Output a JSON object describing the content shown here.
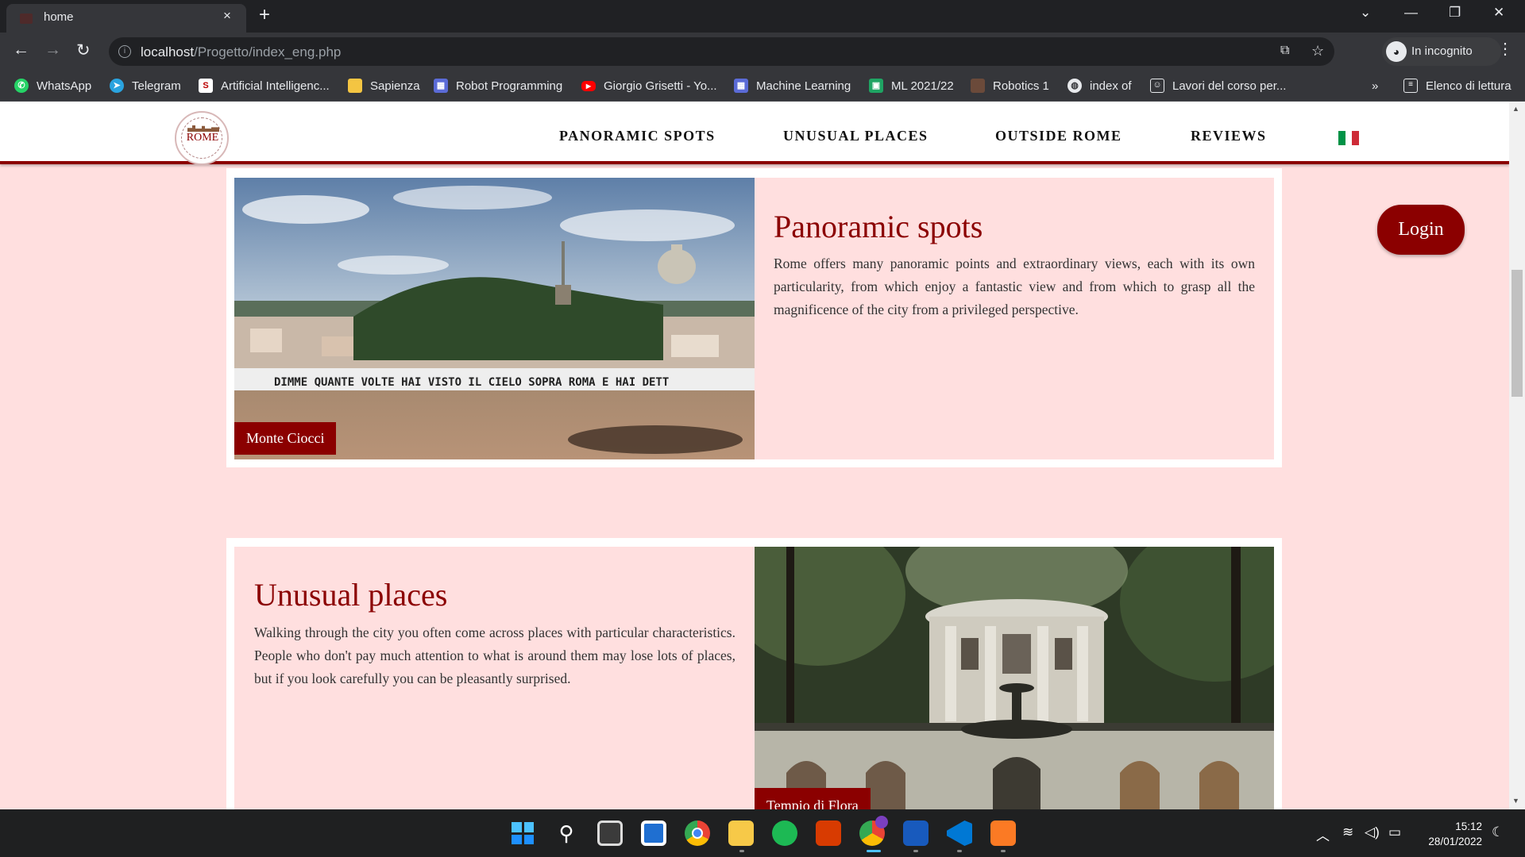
{
  "browser": {
    "tab_title": "home",
    "tab_close": "×",
    "new_tab": "+",
    "url_host": "localhost",
    "url_path": "/Progetto/index_eng.php",
    "incognito_label": "In incognito",
    "bookmarks": [
      {
        "label": "WhatsApp",
        "icon": "whatsapp-icon",
        "color": "#25d366"
      },
      {
        "label": "Telegram",
        "icon": "telegram-icon",
        "color": "#2aa3df"
      },
      {
        "label": "Artificial Intelligenc...",
        "icon": "s-icon",
        "color": "#ffffff"
      },
      {
        "label": "Sapienza",
        "icon": "folder-icon",
        "color": "#f4c542"
      },
      {
        "label": "Robot Programming",
        "icon": "calendar-icon",
        "color": "#5b6bd6"
      },
      {
        "label": "Giorgio Grisetti - Yo...",
        "icon": "youtube-icon",
        "color": "#ff0000"
      },
      {
        "label": "Machine Learning",
        "icon": "calendar-icon",
        "color": "#5b6bd6"
      },
      {
        "label": "ML 2021/22",
        "icon": "classroom-icon",
        "color": "#1fa463"
      },
      {
        "label": "Robotics 1",
        "icon": "avatar-icon",
        "color": "#6b4a3a"
      },
      {
        "label": "index of",
        "icon": "globe-icon",
        "color": "#e8eaed"
      },
      {
        "label": "Lavori del corso per...",
        "icon": "person-icon",
        "color": "#e8eaed"
      }
    ],
    "bookmarks_overflow": "»",
    "reading_list": "Elenco di lettura"
  },
  "site": {
    "logo_text": "ROME",
    "menu": [
      "PANORAMIC SPOTS",
      "UNUSUAL PLACES",
      "OUTSIDE ROME",
      "REVIEWS"
    ],
    "language_flag": "italian-flag-icon",
    "login_label": "Login",
    "accent_color": "#8b0000",
    "background_color": "#ffdfdf"
  },
  "cards": [
    {
      "title": "Panoramic spots",
      "text": "Rome offers many panoramic points and extraordinary views, each with its own particularity, from which enjoy a fantastic view and from which to grasp all the magnificence of the city from a privileged perspective.",
      "photo_caption": "Monte Ciocci",
      "photo_wall_text": "DIMME QUANTE VOLTE HAI VISTO IL CIELO SOPRA ROMA E HAI DETT"
    },
    {
      "title": "Unusual places",
      "text": "Walking through the city you often come across places with particular characteristics. People who don't pay much attention to what is around them may lose lots of places, but if you look carefully you can be pleasantly surprised.",
      "photo_caption": "Tempio di Flora"
    }
  ],
  "taskbar": {
    "time": "15:12",
    "date": "28/01/2022",
    "apps": [
      "start-icon",
      "search-icon",
      "task-view-icon",
      "widgets-icon",
      "chrome-icon",
      "file-explorer-icon",
      "spotify-icon",
      "office-icon",
      "chrome-incognito-icon",
      "word-icon",
      "vscode-icon",
      "xampp-icon"
    ]
  }
}
